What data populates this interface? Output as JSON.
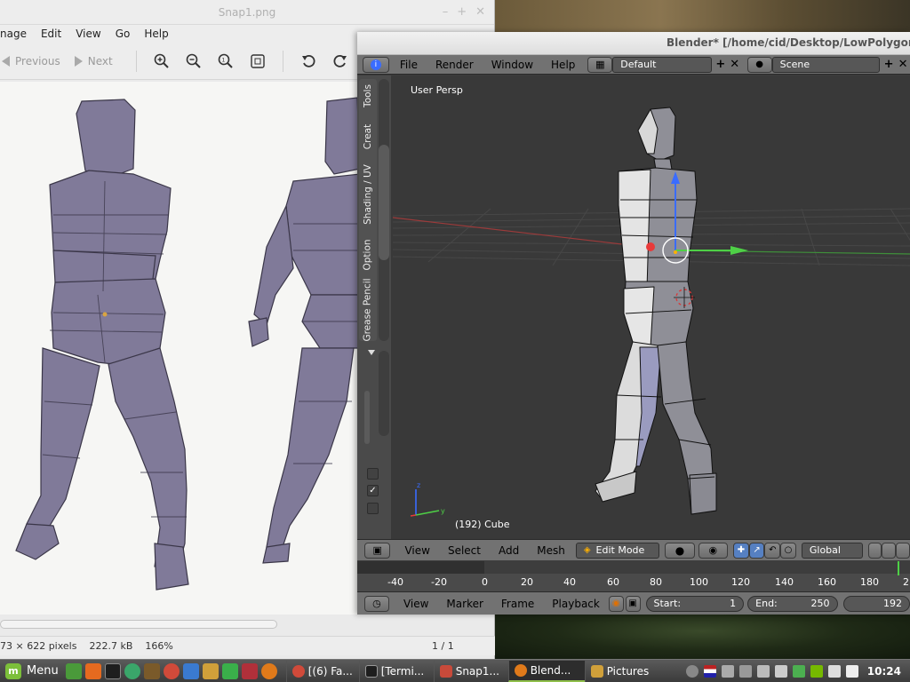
{
  "viewer": {
    "title": "Snap1.png",
    "menu": [
      "nage",
      "Edit",
      "View",
      "Go",
      "Help"
    ],
    "nav_prev": "Previous",
    "nav_next": "Next",
    "toolbar_icons": [
      "zoom-in-icon",
      "zoom-out-icon",
      "zoom-fit-icon",
      "fullscreen-icon",
      "rotate-left-icon",
      "rotate-right-icon"
    ],
    "status": {
      "dimensions": "73 × 622 pixels",
      "size": "222.7 kB",
      "zoom": "166%",
      "page": "1 / 1"
    }
  },
  "blender": {
    "title": "Blender* [/home/cid/Desktop/LowPolygonMa",
    "menu": [
      "File",
      "Render",
      "Window",
      "Help"
    ],
    "layout": "Default",
    "scene": "Scene",
    "tool_tabs": [
      "Tools",
      "Creat",
      "Shading / UV",
      "Option",
      "Grease Pencil"
    ],
    "viewport_label": "User Persp",
    "object_label": "(192) Cube",
    "view_menu": [
      "View",
      "Select",
      "Add",
      "Mesh"
    ],
    "mode": "Edit Mode",
    "orientation": "Global",
    "timeline_ticks": [
      "-40",
      "-20",
      "0",
      "20",
      "40",
      "60",
      "80",
      "100",
      "120",
      "140",
      "160",
      "180",
      "2"
    ],
    "timeline_menu": [
      "View",
      "Marker",
      "Frame",
      "Playback"
    ],
    "start_label": "Start:",
    "start_value": "1",
    "end_label": "End:",
    "end_value": "250",
    "current_frame": "192"
  },
  "taskbar": {
    "menu_label": "Menu",
    "tasks": [
      "[(6) Fa...",
      "[Termi...",
      "Snap1...",
      "Blend...",
      "Pictures"
    ],
    "clock": "10:24"
  },
  "colors": {
    "axis_x": "#e83a3a",
    "axis_y": "#4ed046",
    "axis_z": "#3a6cff",
    "mesh_fill": "#8f8f97",
    "mesh_light": "#d8d8d8",
    "ref_mesh": "#807a99"
  }
}
